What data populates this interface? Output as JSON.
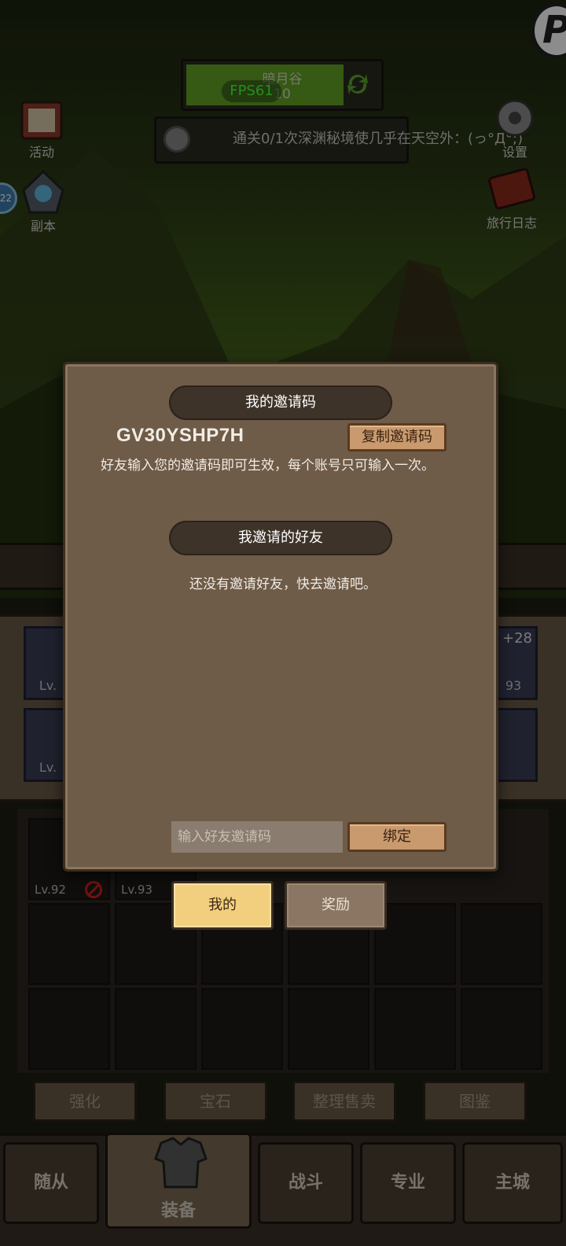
{
  "game": {
    "zone": {
      "name": "暗月谷",
      "level": "10"
    },
    "fps": "FPS61",
    "quest_text": "通关0/1次深渊秘境使几乎在天空外：(っ°Д°;)",
    "side_left": [
      {
        "label": "活动",
        "icon": "calendar-scroll-icon"
      },
      {
        "label": "副本",
        "icon": "dungeon-portal-icon"
      }
    ],
    "side_right": [
      {
        "label": "设置",
        "icon": "gear-icon"
      },
      {
        "label": "旅行日志",
        "icon": "journal-book-icon"
      }
    ],
    "slot_left_labels": [
      "Lv.",
      "Lv."
    ],
    "slot_right_top": {
      "plus": "+28",
      "level": "93"
    },
    "inventory": [
      {
        "level": "Lv.92",
        "locked": true
      },
      {
        "level": "Lv.93",
        "locked": false
      }
    ],
    "actions": [
      "强化",
      "宝石",
      "整理售卖",
      "图鉴"
    ],
    "nav": [
      {
        "label": "随从"
      },
      {
        "label": "装备",
        "active": true
      },
      {
        "label": "战斗"
      },
      {
        "label": "专业"
      },
      {
        "label": "主城"
      }
    ]
  },
  "dialog": {
    "my_code_title": "我的邀请码",
    "invite_code": "GV30YSHP7H",
    "copy_button": "复制邀请码",
    "description": "好友输入您的邀请码即可生效，每个账号只可输入一次。",
    "friends_title": "我邀请的好友",
    "empty_text": "还没有邀请好友，快去邀请吧。",
    "input_placeholder": "输入好友邀请码",
    "bind_button": "绑定"
  },
  "tabs": [
    {
      "label": "我的",
      "selected": true
    },
    {
      "label": "奖励",
      "selected": false
    }
  ],
  "colors": {
    "dialog_bg": "#6e5b48",
    "ribbon_bg": "#3e3329",
    "wood_button": "#c89a6e",
    "tab_selected": "#f2cf7e",
    "fps_green": "#4cff3a"
  }
}
